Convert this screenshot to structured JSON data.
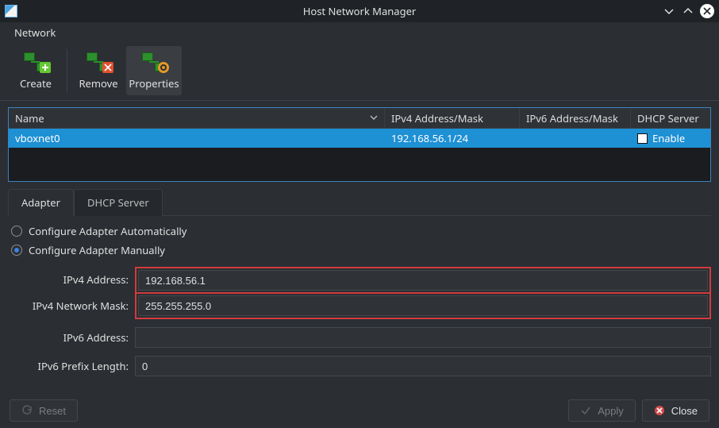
{
  "window": {
    "title": "Host Network Manager"
  },
  "menubar": {
    "network": "Network"
  },
  "toolbar": {
    "create": "Create",
    "remove": "Remove",
    "properties": "Properties"
  },
  "table": {
    "headers": {
      "name": "Name",
      "ipv4": "IPv4 Address/Mask",
      "ipv6": "IPv6 Address/Mask",
      "dhcp": "DHCP Server"
    },
    "rows": [
      {
        "name": "vboxnet0",
        "ipv4": "192.168.56.1/24",
        "ipv6": "",
        "dhcp_enable_label": "Enable",
        "dhcp_checked": false,
        "selected": true
      }
    ]
  },
  "tabs": {
    "adapter": "Adapter",
    "dhcp": "DHCP Server",
    "active": "adapter"
  },
  "adapter": {
    "auto_label": "Configure Adapter Automatically",
    "manual_label": "Configure Adapter Manually",
    "mode": "manual",
    "fields": {
      "ipv4_address_label": "IPv4 Address:",
      "ipv4_address_value": "192.168.56.1",
      "ipv4_mask_label": "IPv4 Network Mask:",
      "ipv4_mask_value": "255.255.255.0",
      "ipv6_address_label": "IPv6 Address:",
      "ipv6_address_value": "",
      "ipv6_prefix_label": "IPv6 Prefix Length:",
      "ipv6_prefix_value": "0"
    }
  },
  "buttons": {
    "reset": "Reset",
    "apply": "Apply",
    "close": "Close"
  }
}
